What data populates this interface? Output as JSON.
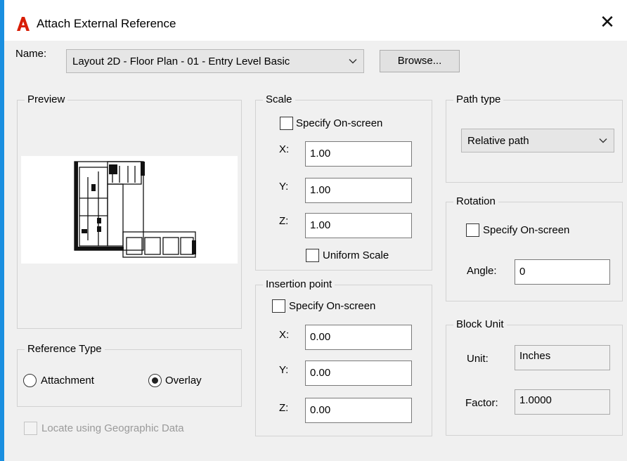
{
  "window": {
    "title": "Attach External Reference",
    "close_glyph": "✕"
  },
  "name_row": {
    "label": "Name:",
    "value": "Layout 2D - Floor Plan - 01 - Entry Level Basic",
    "browse_label": "Browse..."
  },
  "preview": {
    "label": "Preview"
  },
  "reference_type": {
    "label": "Reference Type",
    "options": [
      {
        "label": "Attachment",
        "selected": false
      },
      {
        "label": "Overlay",
        "selected": true
      }
    ]
  },
  "geo": {
    "label": "Locate using Geographic Data",
    "checked": false
  },
  "scale": {
    "label": "Scale",
    "specify_label": "Specify On-screen",
    "x_label": "X:",
    "x_value": "1.00",
    "y_label": "Y:",
    "y_value": "1.00",
    "z_label": "Z:",
    "z_value": "1.00",
    "uniform_label": "Uniform Scale"
  },
  "insertion": {
    "label": "Insertion point",
    "specify_label": "Specify On-screen",
    "x_label": "X:",
    "x_value": "0.00",
    "y_label": "Y:",
    "y_value": "0.00",
    "z_label": "Z:",
    "z_value": "0.00"
  },
  "path_type": {
    "label": "Path type",
    "value": "Relative path"
  },
  "rotation": {
    "label": "Rotation",
    "specify_label": "Specify On-screen",
    "angle_label": "Angle:",
    "angle_value": "0"
  },
  "block_unit": {
    "label": "Block Unit",
    "unit_label": "Unit:",
    "unit_value": "Inches",
    "factor_label": "Factor:",
    "factor_value": "1.0000"
  },
  "colors": {
    "accent": "#1a8fe0",
    "app_icon": "#d81e05"
  }
}
